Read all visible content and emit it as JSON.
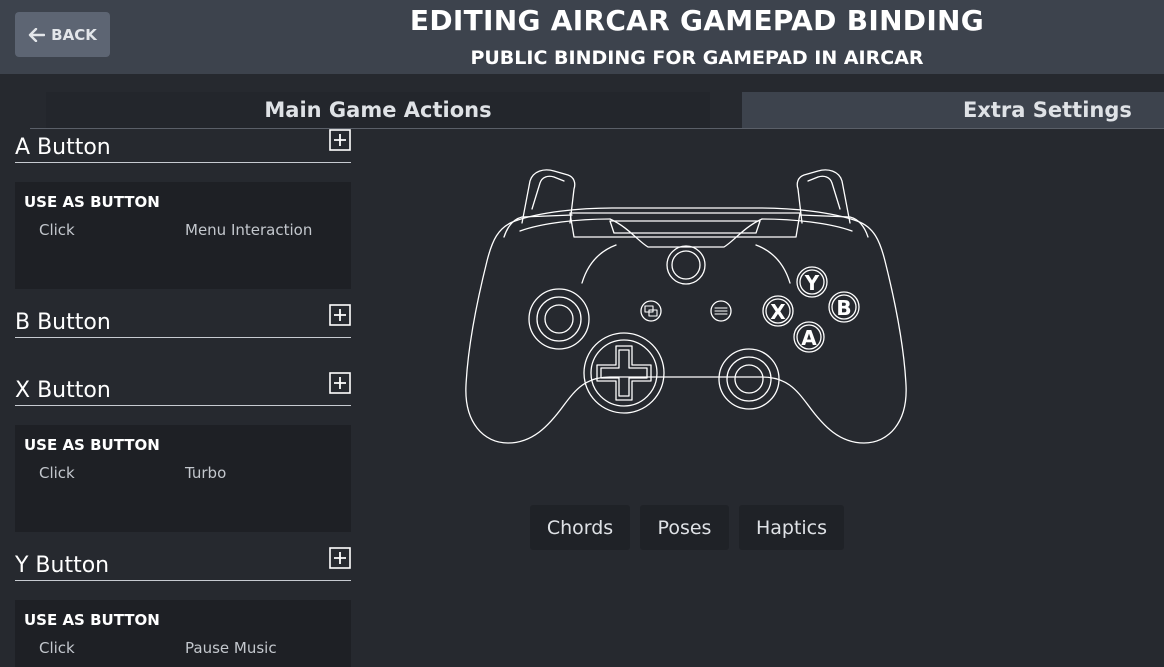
{
  "header": {
    "back_label": "BACK",
    "title": "EDITING AIRCAR GAMEPAD BINDING",
    "subtitle": "PUBLIC BINDING FOR GAMEPAD IN AIRCAR"
  },
  "tabs": [
    {
      "label": "Main Game Actions",
      "active": true
    },
    {
      "label": "Extra Settings",
      "active": false
    }
  ],
  "sections": [
    {
      "name": "A Button",
      "mode": "USE AS BUTTON",
      "trigger": "Click",
      "action": "Menu Interaction"
    },
    {
      "name": "B Button"
    },
    {
      "name": "X Button",
      "mode": "USE AS BUTTON",
      "trigger": "Click",
      "action": "Turbo"
    },
    {
      "name": "Y Button",
      "mode": "USE AS BUTTON",
      "trigger": "Click",
      "action": "Pause Music"
    }
  ],
  "controller": {
    "face_buttons": [
      "Y",
      "B",
      "X",
      "A"
    ]
  },
  "bottom_buttons": [
    "Chords",
    "Poses",
    "Haptics"
  ],
  "colors": {
    "background": "#26292f",
    "header": "#3d434d",
    "card": "#1e2025",
    "back_button": "#5d6573"
  },
  "icons": [
    "arrow-left-icon",
    "plus-box-icon",
    "gamepad-outline-icon"
  ]
}
